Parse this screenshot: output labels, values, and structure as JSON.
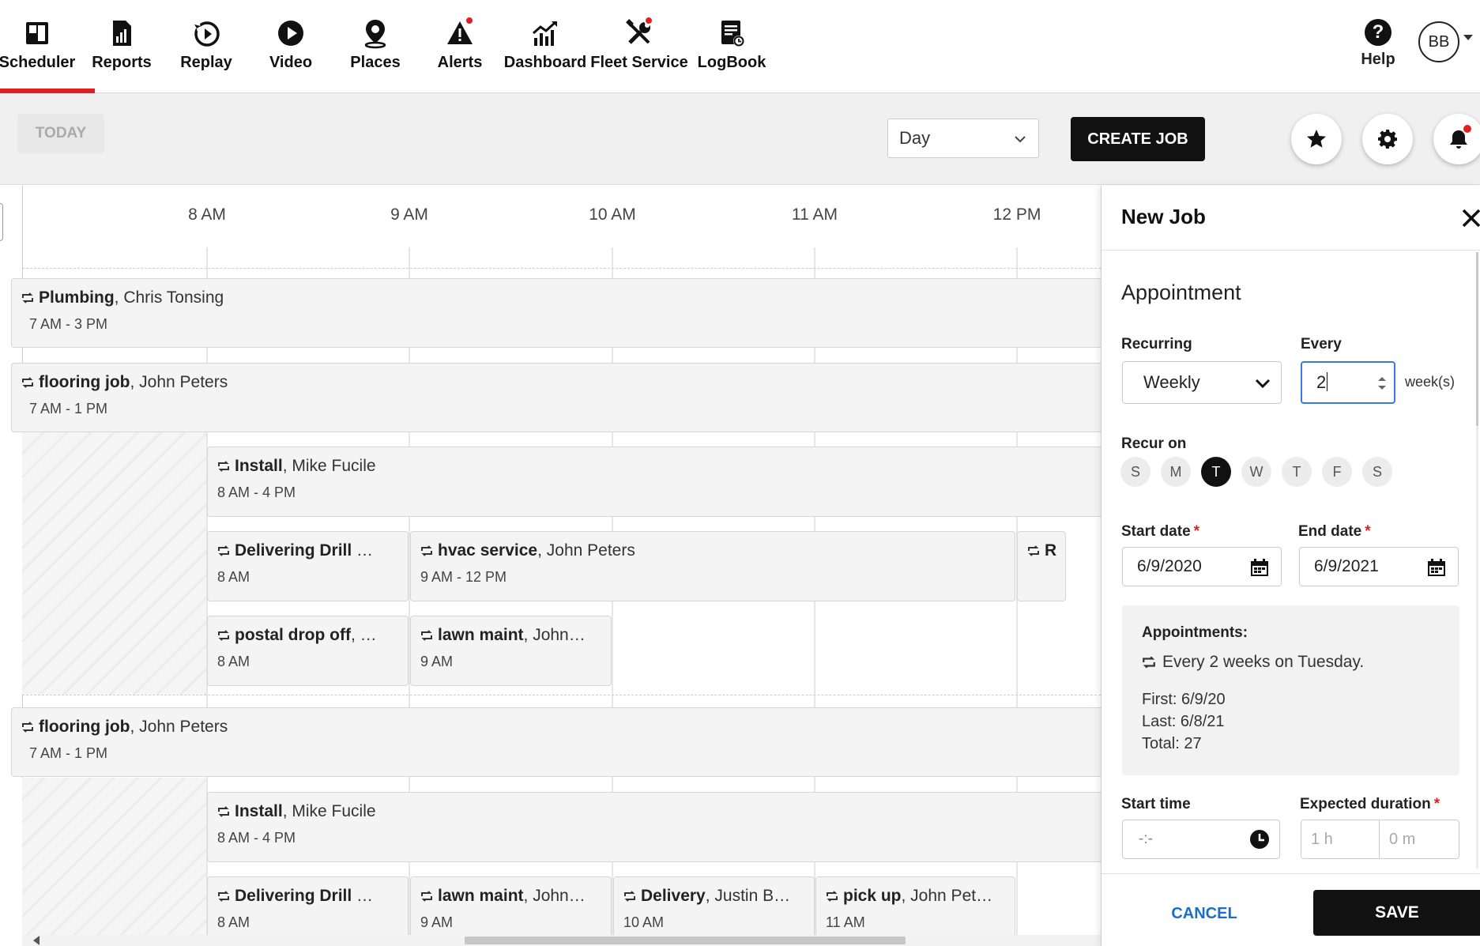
{
  "nav": {
    "items": [
      {
        "label": "Scheduler",
        "icon": "scheduler-icon"
      },
      {
        "label": "Reports",
        "icon": "reports-icon"
      },
      {
        "label": "Replay",
        "icon": "replay-icon"
      },
      {
        "label": "Video",
        "icon": "video-icon"
      },
      {
        "label": "Places",
        "icon": "places-icon"
      },
      {
        "label": "Alerts",
        "icon": "alerts-icon"
      },
      {
        "label": "Dashboard",
        "icon": "dashboard-icon"
      },
      {
        "label": "Fleet Service",
        "icon": "fleet-service-icon"
      },
      {
        "label": "LogBook",
        "icon": "logbook-icon"
      }
    ],
    "active": "Scheduler",
    "help_label": "Help",
    "avatar_initials": "BB",
    "accent_color": "#e02020"
  },
  "toolbar": {
    "today_label": "TODAY",
    "view_value": "Day",
    "create_label": "CREATE JOB"
  },
  "schedule": {
    "hours": [
      "8 AM",
      "9 AM",
      "10 AM",
      "11 AM",
      "12 PM"
    ],
    "jobs": [
      {
        "title": "Plumbing",
        "person": ", Chris Tonsing",
        "time": "7 AM - 3 PM"
      },
      {
        "title": "flooring job",
        "person": ", John Peters",
        "time": "7 AM - 1 PM"
      },
      {
        "title": "Install",
        "person": ", Mike Fucile",
        "time": "8 AM - 4 PM"
      },
      {
        "title": "Delivering Drill",
        "person": " …",
        "time": "8 AM"
      },
      {
        "title": "hvac service",
        "person": ", John Peters",
        "time": "9 AM - 12 PM"
      },
      {
        "title": "R",
        "person": "",
        "time": ""
      },
      {
        "title": "postal drop off",
        "person": ", …",
        "time": "8 AM"
      },
      {
        "title": "lawn maint",
        "person": ", John…",
        "time": "9 AM"
      },
      {
        "title": "flooring job",
        "person": ", John Peters",
        "time": "7 AM - 1 PM"
      },
      {
        "title": "Install",
        "person": ", Mike Fucile",
        "time": "8 AM - 4 PM"
      },
      {
        "title": "Delivering Drill",
        "person": " …",
        "time": "8 AM"
      },
      {
        "title": "lawn maint",
        "person": ", John…",
        "time": "9 AM"
      },
      {
        "title": "Delivery",
        "person": ", Justin B…",
        "time": "10 AM"
      },
      {
        "title": "pick up",
        "person": ", John Pet…",
        "time": "11 AM"
      }
    ]
  },
  "panel": {
    "title": "New Job",
    "section": "Appointment",
    "recurring_label": "Recurring",
    "recurring_value": "Weekly",
    "every_label": "Every",
    "every_value": "2",
    "every_unit": "week(s)",
    "recur_on_label": "Recur on",
    "days": [
      "S",
      "M",
      "T",
      "W",
      "T",
      "F",
      "S"
    ],
    "selected_day_index": 2,
    "start_date_label": "Start date",
    "start_date": "6/9/2020",
    "end_date_label": "End date",
    "end_date": "6/9/2021",
    "required_mark": "*",
    "summary": {
      "heading": "Appointments:",
      "rule": "Every 2 weeks on Tuesday.",
      "first": "First: 6/9/20",
      "last": "Last: 6/8/21",
      "total": "Total: 27"
    },
    "start_time_label": "Start time",
    "start_time_placeholder": "-:-",
    "duration_label": "Expected duration",
    "duration_hours_placeholder": "1 h",
    "duration_minutes_placeholder": "0 m",
    "cancel_label": "CANCEL",
    "save_label": "SAVE"
  }
}
